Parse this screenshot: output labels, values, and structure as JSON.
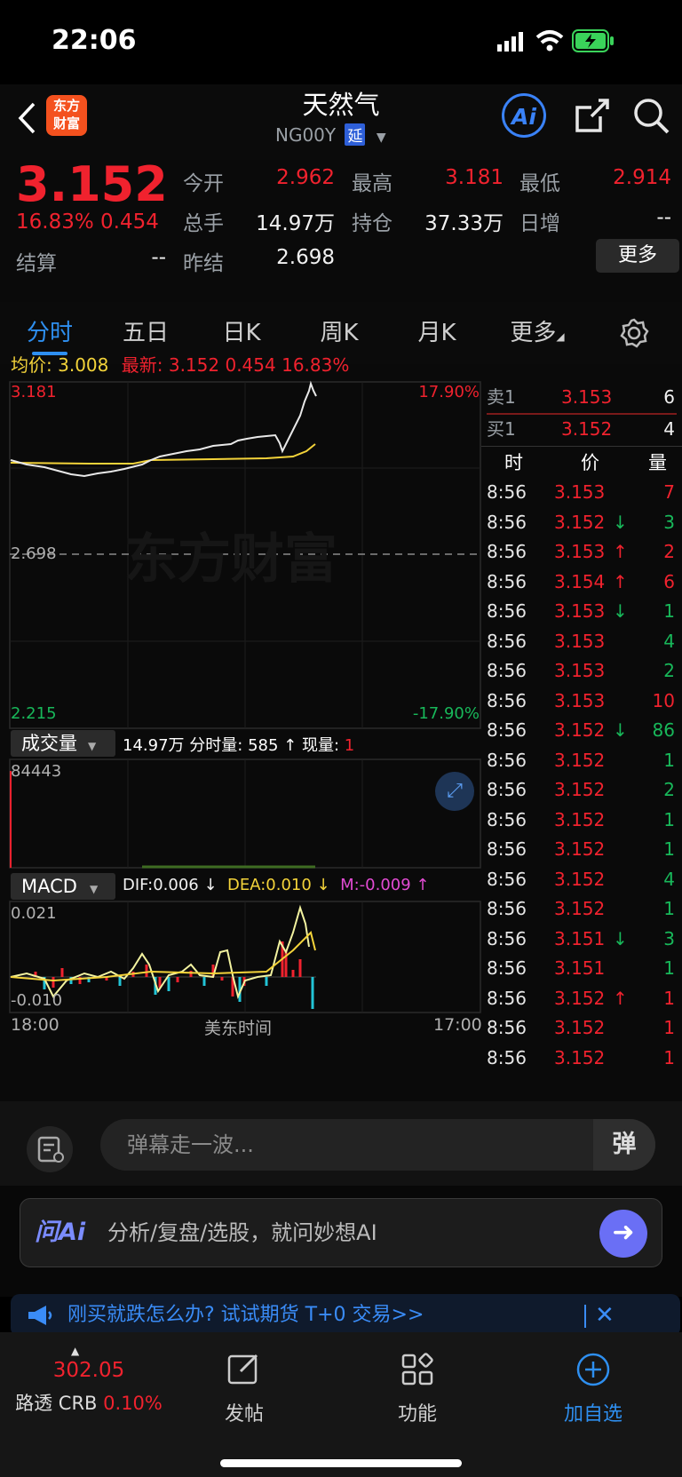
{
  "status_bar": {
    "time": "22:06"
  },
  "header": {
    "title": "天然气",
    "code": "NG00Y",
    "delay_badge": "延",
    "logo_line1": "东方",
    "logo_line2": "财富",
    "ai_label": "Ai"
  },
  "quote": {
    "price": "3.152",
    "change_pct": "16.83%",
    "change": "0.454",
    "fields": [
      {
        "label": "今开",
        "value": "2.962"
      },
      {
        "label": "最高",
        "value": "3.181"
      },
      {
        "label": "最低",
        "value": "2.914"
      },
      {
        "label": "总手",
        "value": "14.97万"
      },
      {
        "label": "持仓",
        "value": "37.33万"
      },
      {
        "label": "日增",
        "value": "--"
      },
      {
        "label": "结算",
        "value": "--"
      },
      {
        "label": "昨结",
        "value": "2.698"
      }
    ],
    "more_button": "更多"
  },
  "tabs": [
    {
      "label": "分时"
    },
    {
      "label": "五日"
    },
    {
      "label": "日K"
    },
    {
      "label": "周K"
    },
    {
      "label": "月K"
    },
    {
      "label": "更多"
    }
  ],
  "info_line": {
    "avg_label": "均价:",
    "avg_value": "3.008",
    "latest_label": "最新:",
    "latest_value": "3.152",
    "change": "0.454",
    "change_pct": "16.83%"
  },
  "main_chart": {
    "y_high": "3.181",
    "y_mid": "2.698",
    "y_low": "2.215",
    "pct_high": "17.90%",
    "pct_low": "-17.90%",
    "watermark": "东方财富"
  },
  "volume": {
    "selector": "成交量",
    "total": "14.97万",
    "period_label": "分时量:",
    "period_value": "585 ↑",
    "now_label": "现量:",
    "now_value": "1",
    "max_label": "84443"
  },
  "macd": {
    "selector": "MACD",
    "dif": "DIF:0.006 ↓",
    "dea": "DEA:0.010 ↓",
    "m": "M:-0.009 ↑",
    "y_high": "0.021",
    "y_low": "-0.010"
  },
  "time_axis": {
    "start": "18:00",
    "middle": "美东时间",
    "end": "17:00"
  },
  "order_book": {
    "ask": {
      "label": "卖1",
      "price": "3.153",
      "qty": "6"
    },
    "bid": {
      "label": "买1",
      "price": "3.152",
      "qty": "4"
    },
    "headers": [
      "时",
      "价",
      "量"
    ],
    "trades": [
      {
        "time": "8:56",
        "price": "3.153",
        "dir": "",
        "qty": "7",
        "qty_color": "red"
      },
      {
        "time": "8:56",
        "price": "3.152",
        "dir": "↓",
        "qty": "3",
        "qty_color": "green"
      },
      {
        "time": "8:56",
        "price": "3.153",
        "dir": "↑",
        "qty": "2",
        "qty_color": "red"
      },
      {
        "time": "8:56",
        "price": "3.154",
        "dir": "↑",
        "qty": "6",
        "qty_color": "red"
      },
      {
        "time": "8:56",
        "price": "3.153",
        "dir": "↓",
        "qty": "1",
        "qty_color": "green"
      },
      {
        "time": "8:56",
        "price": "3.153",
        "dir": "",
        "qty": "4",
        "qty_color": "green"
      },
      {
        "time": "8:56",
        "price": "3.153",
        "dir": "",
        "qty": "2",
        "qty_color": "green"
      },
      {
        "time": "8:56",
        "price": "3.153",
        "dir": "",
        "qty": "10",
        "qty_color": "red"
      },
      {
        "time": "8:56",
        "price": "3.152",
        "dir": "↓",
        "qty": "86",
        "qty_color": "green"
      },
      {
        "time": "8:56",
        "price": "3.152",
        "dir": "",
        "qty": "1",
        "qty_color": "green"
      },
      {
        "time": "8:56",
        "price": "3.152",
        "dir": "",
        "qty": "2",
        "qty_color": "green"
      },
      {
        "time": "8:56",
        "price": "3.152",
        "dir": "",
        "qty": "1",
        "qty_color": "green"
      },
      {
        "time": "8:56",
        "price": "3.152",
        "dir": "",
        "qty": "1",
        "qty_color": "green"
      },
      {
        "time": "8:56",
        "price": "3.152",
        "dir": "",
        "qty": "4",
        "qty_color": "green"
      },
      {
        "time": "8:56",
        "price": "3.152",
        "dir": "",
        "qty": "1",
        "qty_color": "green"
      },
      {
        "time": "8:56",
        "price": "3.151",
        "dir": "↓",
        "qty": "3",
        "qty_color": "green"
      },
      {
        "time": "8:56",
        "price": "3.151",
        "dir": "",
        "qty": "1",
        "qty_color": "green"
      },
      {
        "time": "8:56",
        "price": "3.152",
        "dir": "↑",
        "qty": "1",
        "qty_color": "red"
      },
      {
        "time": "8:56",
        "price": "3.152",
        "dir": "",
        "qty": "1",
        "qty_color": "red"
      },
      {
        "time": "8:56",
        "price": "3.152",
        "dir": "",
        "qty": "1",
        "qty_color": "red"
      }
    ]
  },
  "danmu": {
    "placeholder": "弹幕走一波...",
    "toggle_label": "弹"
  },
  "ai_box": {
    "brand": "问Ai",
    "placeholder": "分析/复盘/选股，就问妙想AI"
  },
  "banner": {
    "text": "刚买就跌怎么办? 试试期货 T+0 交易>>"
  },
  "bottom_nav": {
    "index_value": "302.05",
    "index_name": "路透 CRB",
    "index_change": "0.10%",
    "items": [
      {
        "label": "发帖"
      },
      {
        "label": "功能"
      },
      {
        "label": "加自选"
      }
    ]
  },
  "colors": {
    "up": "#f0222e",
    "down": "#18b85a",
    "accent": "#2e8ff0",
    "avg_line": "#f3d33a"
  }
}
